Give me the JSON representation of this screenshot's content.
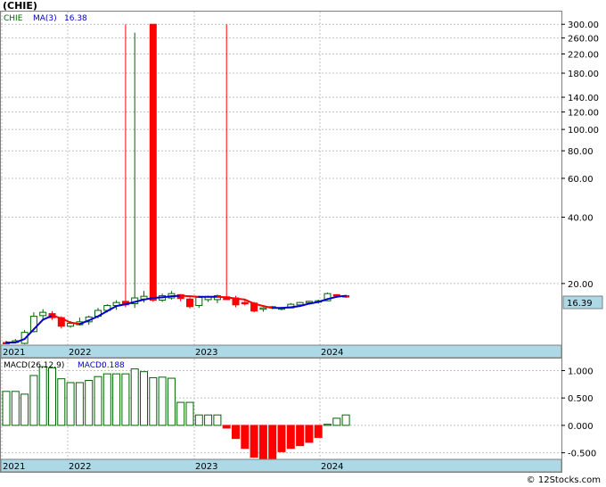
{
  "header": {
    "title": "(CHIE)"
  },
  "footer": {
    "copyright": "© 12Stocks.com"
  },
  "legend": {
    "symbol": "CHIE",
    "ma_label": "MA(3)",
    "ma_value": "16.38",
    "macd_params": "MACD(26,12,9)",
    "macd_label": "MACD:",
    "macd_value": "0.188"
  },
  "last_price_label": "16.39",
  "colors": {
    "up": "#006400",
    "down": "#ff0000",
    "ma_rising": "#0000cc",
    "ma_falling": "#ff0000",
    "axis_band": "#add8e6"
  },
  "chart_data": [
    {
      "type": "candlestick",
      "scale": "log",
      "x_tick_labels": [
        "2021",
        "2022",
        "2023",
        "2024"
      ],
      "y_tick_labels": [
        "300.00",
        "260.00",
        "220.00",
        "180.00",
        "140.00",
        "120.00",
        "100.00",
        "80.00",
        "60.00",
        "40.00",
        "20.00"
      ],
      "y_ticks": [
        300,
        260,
        220,
        180,
        140,
        120,
        100,
        80,
        60,
        40,
        20
      ],
      "ylim": [
        10.5,
        330
      ],
      "grid": true,
      "candles": [
        {
          "o": 10.8,
          "h": 11.0,
          "l": 10.6,
          "c": 10.7
        },
        {
          "o": 10.8,
          "h": 11.2,
          "l": 10.7,
          "c": 11.0
        },
        {
          "o": 10.7,
          "h": 12.3,
          "l": 10.6,
          "c": 12.0
        },
        {
          "o": 12.1,
          "h": 14.8,
          "l": 12.0,
          "c": 14.2
        },
        {
          "o": 14.3,
          "h": 15.3,
          "l": 13.8,
          "c": 14.8
        },
        {
          "o": 14.6,
          "h": 15.0,
          "l": 13.7,
          "c": 14.0
        },
        {
          "o": 14.0,
          "h": 14.2,
          "l": 12.5,
          "c": 12.8
        },
        {
          "o": 12.8,
          "h": 13.5,
          "l": 12.6,
          "c": 13.2
        },
        {
          "o": 13.0,
          "h": 14.0,
          "l": 12.9,
          "c": 13.4
        },
        {
          "o": 13.4,
          "h": 14.3,
          "l": 13.0,
          "c": 14.1
        },
        {
          "o": 14.2,
          "h": 15.5,
          "l": 13.9,
          "c": 15.1
        },
        {
          "o": 15.1,
          "h": 16.1,
          "l": 14.8,
          "c": 15.9
        },
        {
          "o": 15.9,
          "h": 16.8,
          "l": 15.2,
          "c": 16.4
        },
        {
          "o": 16.6,
          "h": 300,
          "l": 15.6,
          "c": 16.0
        },
        {
          "o": 16.2,
          "h": 275,
          "l": 15.5,
          "c": 17.2
        },
        {
          "o": 17.0,
          "h": 18.5,
          "l": 16.4,
          "c": 17.5
        },
        {
          "o": 300,
          "h": 300,
          "l": 16.5,
          "c": 16.8
        },
        {
          "o": 16.8,
          "h": 18.0,
          "l": 16.5,
          "c": 17.6
        },
        {
          "o": 17.2,
          "h": 18.5,
          "l": 16.9,
          "c": 18.0
        },
        {
          "o": 17.8,
          "h": 17.9,
          "l": 16.6,
          "c": 17.1
        },
        {
          "o": 17.0,
          "h": 17.3,
          "l": 15.4,
          "c": 15.7
        },
        {
          "o": 15.9,
          "h": 17.5,
          "l": 15.5,
          "c": 17.3
        },
        {
          "o": 16.9,
          "h": 17.6,
          "l": 16.5,
          "c": 17.4
        },
        {
          "o": 16.9,
          "h": 17.8,
          "l": 16.3,
          "c": 17.6
        },
        {
          "o": 17.4,
          "h": 300,
          "l": 16.8,
          "c": 16.9
        },
        {
          "o": 17.2,
          "h": 17.6,
          "l": 15.6,
          "c": 16.0
        },
        {
          "o": 16.4,
          "h": 16.8,
          "l": 15.9,
          "c": 16.2
        },
        {
          "o": 16.3,
          "h": 16.5,
          "l": 14.8,
          "c": 15.0
        },
        {
          "o": 15.3,
          "h": 15.6,
          "l": 14.9,
          "c": 15.5
        },
        {
          "o": 15.5,
          "h": 15.8,
          "l": 15.3,
          "c": 15.7
        },
        {
          "o": 15.4,
          "h": 15.6,
          "l": 15.1,
          "c": 15.5
        },
        {
          "o": 15.5,
          "h": 16.3,
          "l": 15.4,
          "c": 16.1
        },
        {
          "o": 16.0,
          "h": 16.5,
          "l": 15.8,
          "c": 16.4
        },
        {
          "o": 16.4,
          "h": 16.7,
          "l": 16.1,
          "c": 16.6
        },
        {
          "o": 16.5,
          "h": 16.9,
          "l": 16.2,
          "c": 16.7
        },
        {
          "o": 16.7,
          "h": 18.2,
          "l": 16.7,
          "c": 18.0
        },
        {
          "o": 17.8,
          "h": 17.9,
          "l": 17.4,
          "c": 17.6
        },
        {
          "o": 17.6,
          "h": 17.7,
          "l": 17.2,
          "c": 17.4
        }
      ],
      "ma_series": [
        10.8,
        10.8,
        11.2,
        12.4,
        13.7,
        14.3,
        13.9,
        13.3,
        13.1,
        13.6,
        14.2,
        15.0,
        15.8,
        16.1,
        16.5,
        16.9,
        17.2,
        17.3,
        17.5,
        17.6,
        17.5,
        17.4,
        17.4,
        17.4,
        17.3,
        17.1,
        16.9,
        16.2,
        15.8,
        15.5,
        15.5,
        15.6,
        15.8,
        16.2,
        16.5,
        17.0,
        17.4,
        17.6
      ]
    },
    {
      "type": "bar",
      "title": "MACD(26,12,9)",
      "x_tick_labels": [
        "2021",
        "2022",
        "2023",
        "2024"
      ],
      "y_tick_labels": [
        "1.000",
        "0.500",
        "0.000",
        "-0.500"
      ],
      "y_ticks": [
        1.0,
        0.5,
        0.0,
        -0.5
      ],
      "ylim": [
        -0.62,
        1.17
      ],
      "grid": true,
      "values": [
        0.62,
        0.62,
        0.57,
        0.91,
        1.07,
        1.05,
        0.85,
        0.78,
        0.78,
        0.82,
        0.89,
        0.94,
        0.94,
        0.94,
        1.03,
        0.98,
        0.87,
        0.88,
        0.86,
        0.42,
        0.42,
        0.19,
        0.19,
        0.19,
        -0.05,
        -0.24,
        -0.42,
        -0.58,
        -0.61,
        -0.61,
        -0.48,
        -0.42,
        -0.37,
        -0.31,
        -0.22,
        0.02,
        0.13,
        0.19
      ]
    }
  ]
}
